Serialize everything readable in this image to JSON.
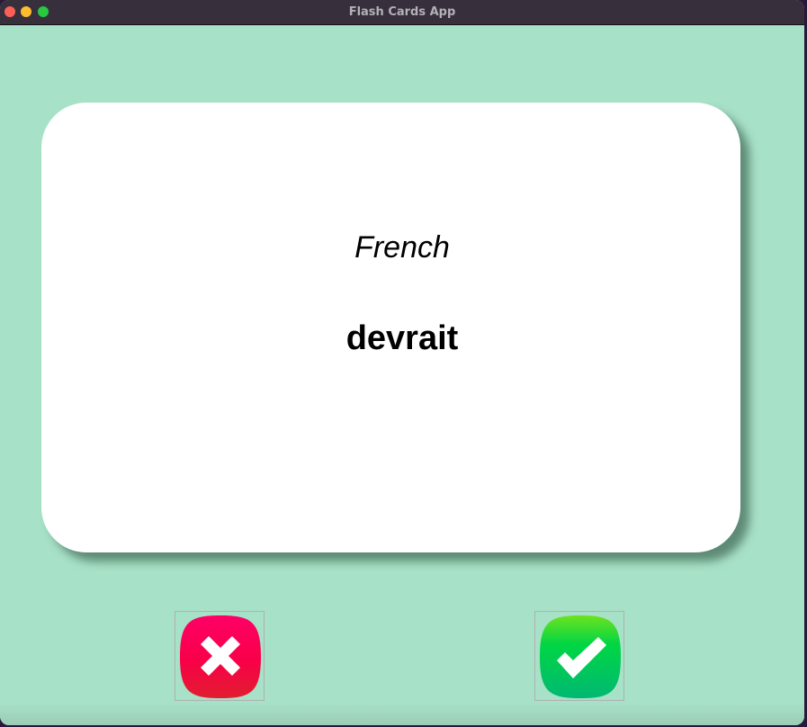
{
  "window": {
    "title": "Flash Cards App"
  },
  "card": {
    "language": "French",
    "word": "devrait"
  },
  "buttons": {
    "wrong": {
      "icon": "cross-icon",
      "colors": [
        "#ff0066",
        "#e21d2f"
      ]
    },
    "right": {
      "icon": "checkmark-icon",
      "colors": [
        "#6de21f",
        "#00d44a",
        "#00b870"
      ]
    }
  },
  "colors": {
    "background": "#a7e1c7",
    "card": "#ffffff",
    "titlebar": "#37303c"
  }
}
